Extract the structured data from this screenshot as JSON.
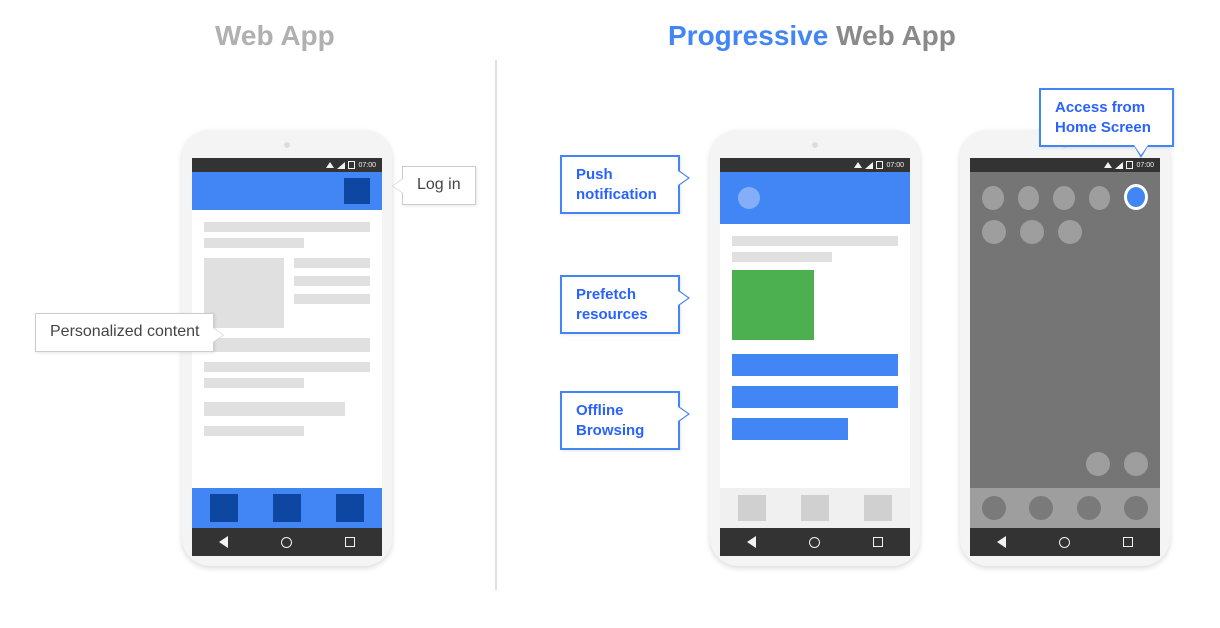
{
  "titles": {
    "left": "Web App",
    "right_accent": "Progressive",
    "right_rest": " Web App"
  },
  "statusbar_time": "07:00",
  "callouts": {
    "login": "Log in",
    "personalized": "Personalized content",
    "push": "Push notification",
    "prefetch": "Prefetch resources",
    "offline": "Offline Browsing",
    "home": "Access from Home Screen"
  }
}
